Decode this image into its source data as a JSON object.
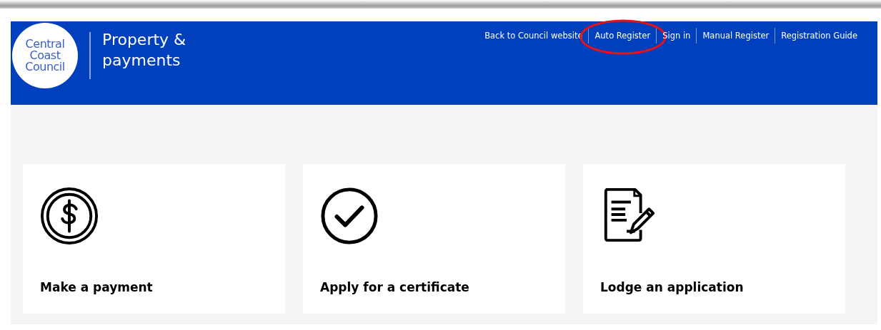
{
  "header": {
    "logo": [
      "Central",
      "Coast",
      "Council"
    ],
    "title": [
      "Property &",
      "payments"
    ]
  },
  "nav": [
    {
      "label": "Back to Council website",
      "circled": false
    },
    {
      "label": "Auto Register",
      "circled": true
    },
    {
      "label": "Sign in",
      "circled": false
    },
    {
      "label": "Manual Register",
      "circled": false
    },
    {
      "label": "Registration Guide",
      "circled": false
    }
  ],
  "cards": [
    {
      "kind": "payment",
      "label": "Make a payment"
    },
    {
      "kind": "certificate",
      "label": "Apply for a certificate"
    },
    {
      "kind": "application",
      "label": "Lodge an application"
    }
  ]
}
